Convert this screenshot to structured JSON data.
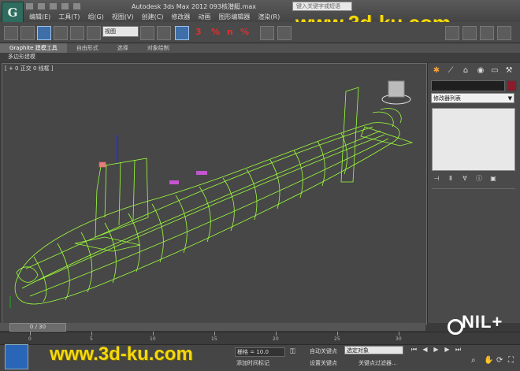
{
  "app": {
    "title": "Autodesk 3ds Max  2012      093核潜艇.max",
    "search_placeholder": "键入关键字或短语",
    "logo_letter": "G"
  },
  "menu": {
    "items": [
      "编辑(E)",
      "工具(T)",
      "组(G)",
      "视图(V)",
      "创建(C)",
      "修改器",
      "动画",
      "图形编辑器",
      "渲染(R)"
    ]
  },
  "watermark": {
    "text": "www.3d-ku.com"
  },
  "toolbar": {
    "view_dropdown": "视图",
    "glyphs": [
      "3",
      "%",
      "n",
      "%"
    ]
  },
  "ribbon": {
    "tabs": [
      "Graphite 建模工具",
      "自由形式",
      "选择",
      "对象绘制"
    ],
    "sub_label": "多边形建模"
  },
  "viewport": {
    "label": "[ + 0 正交 0 线框 ]"
  },
  "command_panel": {
    "modifier_list": "修改器列表",
    "accent": "#8b1c2b"
  },
  "timeline": {
    "position": "0 / 30",
    "ticks": [
      "0",
      "5",
      "10",
      "15",
      "20",
      "25",
      "30"
    ]
  },
  "status": {
    "grid_value": "栅格 = 10.0",
    "auto_key": "自动关键点",
    "set_key": "设置关键点",
    "selected": "选定对象",
    "key_filter": "关键点过滤器...",
    "add_time_tag": "添加时间标记"
  },
  "branding": {
    "corner_logo": "NIL+"
  }
}
